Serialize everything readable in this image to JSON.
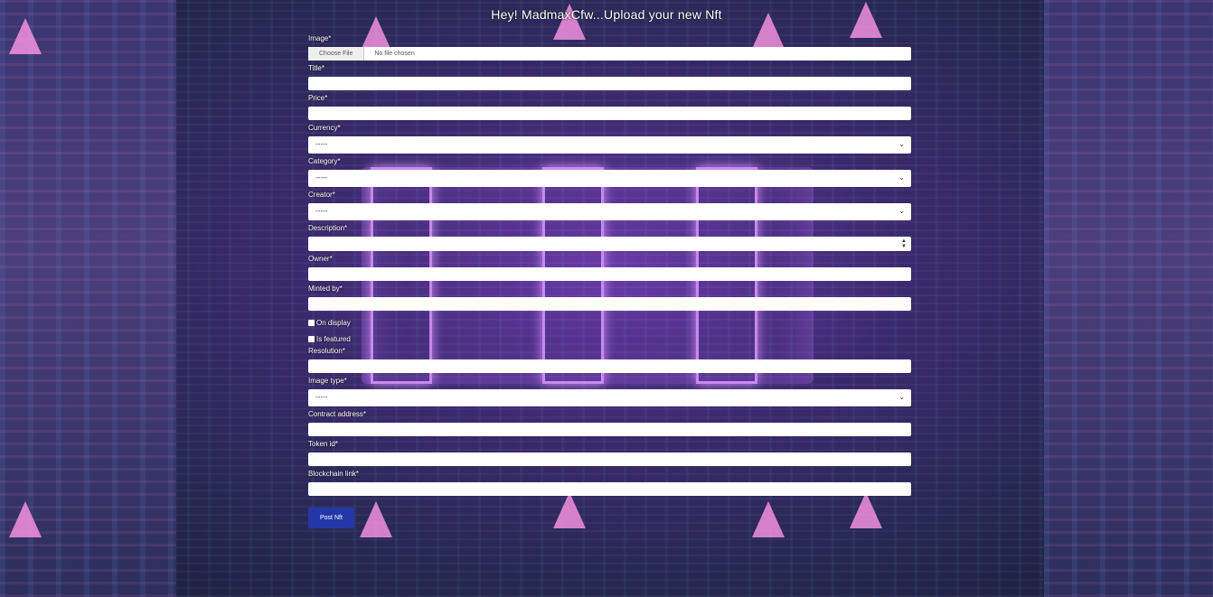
{
  "header": {
    "title": "Hey! MadmaxCfw...Upload your new Nft"
  },
  "form": {
    "image": {
      "label": "Image*",
      "button": "Choose File",
      "status": "No file chosen"
    },
    "title": {
      "label": "Title*",
      "value": ""
    },
    "price": {
      "label": "Price*",
      "value": ""
    },
    "currency": {
      "label": "Currency*",
      "value": "-----"
    },
    "category": {
      "label": "Category*",
      "value": "-----"
    },
    "creator": {
      "label": "Creator*",
      "value": "-----"
    },
    "description": {
      "label": "Description*",
      "value": ""
    },
    "owner": {
      "label": "Owner*",
      "value": ""
    },
    "minted_by": {
      "label": "Minted by*",
      "value": ""
    },
    "on_display": {
      "label": "On display",
      "checked": false
    },
    "is_featured": {
      "label": "Is featured",
      "checked": false
    },
    "resolution": {
      "label": "Resolution*",
      "value": ""
    },
    "image_type": {
      "label": "Image type*",
      "value": "-----"
    },
    "contract_address": {
      "label": "Contract address*",
      "value": ""
    },
    "token_id": {
      "label": "Token id*",
      "value": ""
    },
    "blockchain_link": {
      "label": "Blockchain link*",
      "value": ""
    },
    "submit": {
      "label": "Post Nft"
    }
  },
  "icons": {
    "select": "chevron-down-icon",
    "spinner": "spinner-arrows-icon"
  }
}
